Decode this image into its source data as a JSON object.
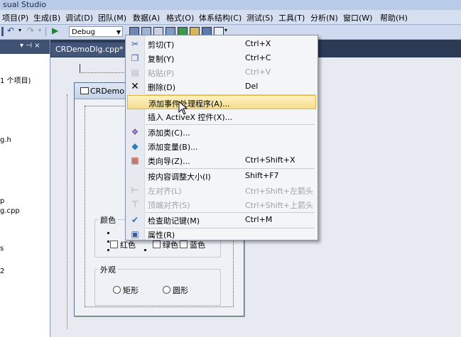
{
  "window": {
    "title": "sual Studio"
  },
  "menubar": {
    "items": [
      "项目(P)",
      "生成(B)",
      "调试(D)",
      "团队(M)",
      "数据(A)",
      "格式(O)",
      "体系结构(C)",
      "测试(S)",
      "工具(T)",
      "分析(N)",
      "窗口(W)",
      "帮助(H)"
    ]
  },
  "toolbar": {
    "config": "Debug"
  },
  "solution_panel": {
    "header": "▾ ⊣ ×",
    "lines": [
      "1 个项目)",
      "g.h",
      "p",
      "g.cpp",
      "s",
      "2"
    ]
  },
  "tabs": {
    "active": "CRDemoDlg.cpp*"
  },
  "dialog": {
    "title": "CRDemo",
    "color_group": {
      "label": "颜色",
      "checkboxes": [
        "红色",
        "绿色",
        "蓝色"
      ]
    },
    "look_group": {
      "label": "外观",
      "radios": [
        "矩形",
        "圆形"
      ]
    }
  },
  "context_menu": {
    "items": [
      {
        "label": "剪切(T)",
        "shortcut": "Ctrl+X",
        "icon": "scissors-icon",
        "disabled": false
      },
      {
        "label": "复制(Y)",
        "shortcut": "Ctrl+C",
        "icon": "copy-icon",
        "disabled": false
      },
      {
        "label": "粘贴(P)",
        "shortcut": "Ctrl+V",
        "icon": "paste-icon",
        "disabled": true
      },
      {
        "label": "删除(D)",
        "shortcut": "Del",
        "icon": "delete-icon",
        "disabled": false
      },
      {
        "label": "添加事件处理程序(A)...",
        "shortcut": "",
        "icon": "",
        "disabled": false
      },
      {
        "label": "插入 ActiveX 控件(X)...",
        "shortcut": "",
        "icon": "",
        "disabled": false
      },
      {
        "label": "添加类(C)...",
        "shortcut": "",
        "icon": "add-class-icon",
        "disabled": false
      },
      {
        "label": "添加变量(B)...",
        "shortcut": "",
        "icon": "add-variable-icon",
        "disabled": false
      },
      {
        "label": "类向导(Z)...",
        "shortcut": "Ctrl+Shift+X",
        "icon": "class-wizard-icon",
        "disabled": false
      },
      {
        "label": "按内容调整大小(I)",
        "shortcut": "Shift+F7",
        "icon": "",
        "disabled": false
      },
      {
        "label": "左对齐(L)",
        "shortcut": "Ctrl+Shift+左箭头",
        "icon": "align-left-icon",
        "disabled": true
      },
      {
        "label": "顶端对齐(S)",
        "shortcut": "Ctrl+Shift+上箭头",
        "icon": "align-top-icon",
        "disabled": true
      },
      {
        "label": "检查助记键(M)",
        "shortcut": "Ctrl+M",
        "icon": "check-mnemonics-icon",
        "disabled": false
      },
      {
        "label": "属性(R)",
        "shortcut": "",
        "icon": "properties-icon",
        "disabled": false
      }
    ]
  },
  "colors": {
    "menu_highlight": "#f6dd8c",
    "chrome_dark": "#2b3a55",
    "menubar": "#d6dff0"
  }
}
